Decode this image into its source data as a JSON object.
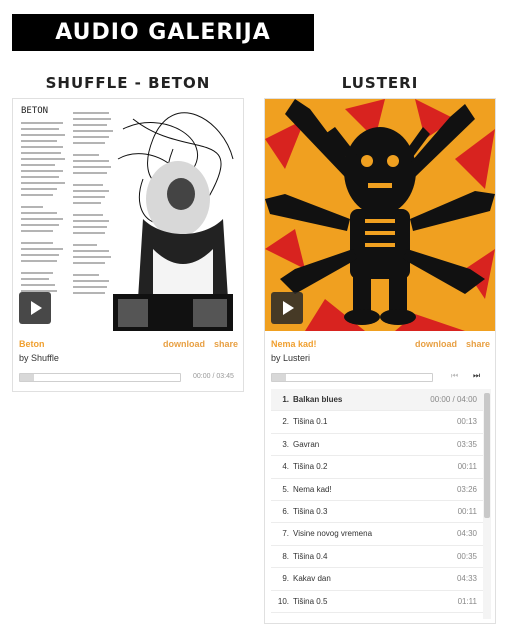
{
  "page": {
    "title": "AUDIO GALERIJA"
  },
  "albums": [
    {
      "title": "SHUFFLE - BETON",
      "cover_lyrics_heading": "BETON",
      "track": "Beton",
      "artist": "by Shuffle",
      "download_label": "download",
      "share_label": "share",
      "time": "00:00 / 03:45",
      "progress": 0
    },
    {
      "title": "LUSTERI",
      "track": "Nema kad!",
      "artist": "by Lusteri",
      "download_label": "download",
      "share_label": "share",
      "prev_icon": "⏮",
      "next_icon": "⏭",
      "progress": 0,
      "tracks": [
        {
          "n": "1.",
          "title": "Balkan blues",
          "dur": "00:00 / 04:00"
        },
        {
          "n": "2.",
          "title": "Tišina 0.1",
          "dur": "00:13"
        },
        {
          "n": "3.",
          "title": "Gavran",
          "dur": "03:35"
        },
        {
          "n": "4.",
          "title": "Tišina 0.2",
          "dur": "00:11"
        },
        {
          "n": "5.",
          "title": "Nema kad!",
          "dur": "03:26"
        },
        {
          "n": "6.",
          "title": "Tišina 0.3",
          "dur": "00:11"
        },
        {
          "n": "7.",
          "title": "Visine novog vremena",
          "dur": "04:30"
        },
        {
          "n": "8.",
          "title": "Tišina 0.4",
          "dur": "00:35"
        },
        {
          "n": "9.",
          "title": "Kakav dan",
          "dur": "04:33"
        },
        {
          "n": "10.",
          "title": "Tišina 0.5",
          "dur": "01:11"
        }
      ]
    }
  ],
  "colors": {
    "accent": "#e8a043",
    "title_bg": "#000000",
    "cover2_bg": "#f0a020",
    "cover2_red": "#d8231f"
  }
}
